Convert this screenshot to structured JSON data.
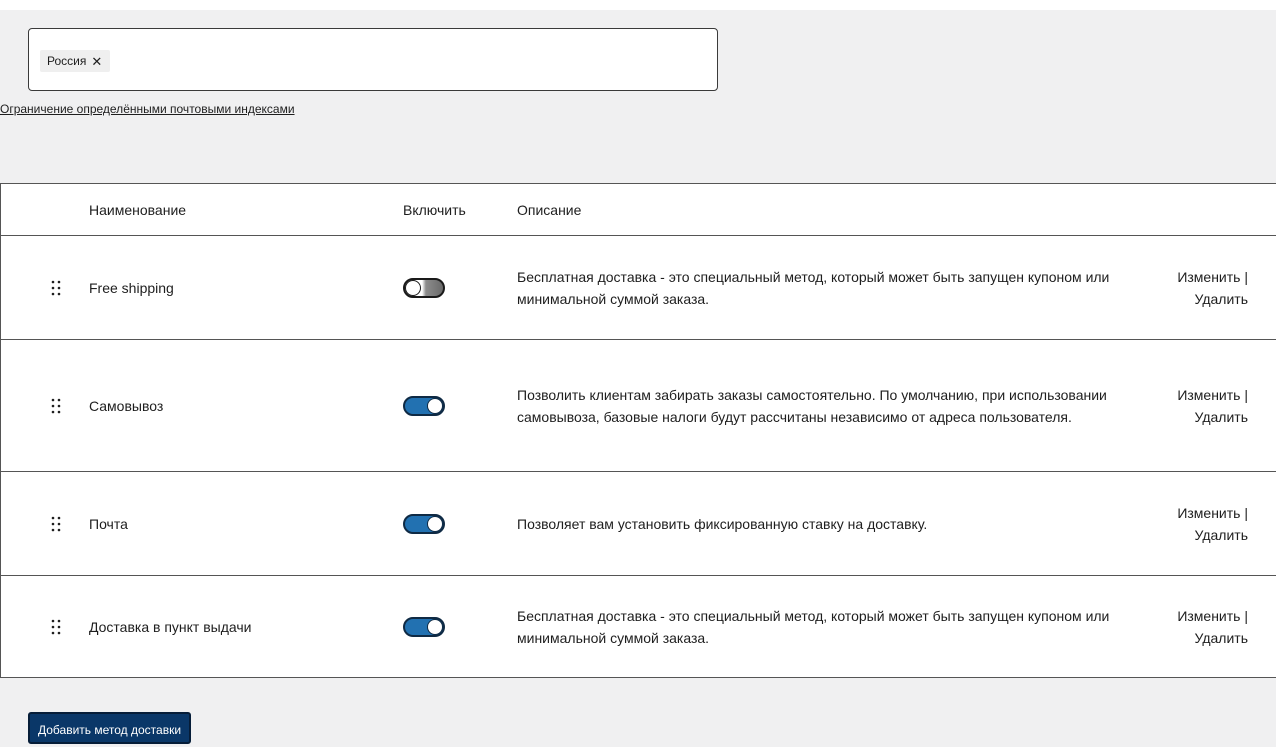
{
  "region": {
    "chips": [
      {
        "label": "Россия",
        "remove_glyph": "✕"
      }
    ]
  },
  "postcode_link": "Ограничение определёнными почтовыми индексами",
  "table": {
    "headers": {
      "name": "Наименование",
      "enable": "Включить",
      "description": "Описание"
    },
    "rows": [
      {
        "name": "Free shipping",
        "enabled": false,
        "description": "Бесплатная доставка - это специальный метод, который может быть запущен купоном или минимальной суммой заказа.",
        "edit_label": "Изменить",
        "separator": "|",
        "delete_label": "Удалить"
      },
      {
        "name": "Самовывоз",
        "enabled": true,
        "description": "Позволить клиентам забирать заказы самостоятельно. По умолчанию, при использовании самовывоза, базовые налоги будут рассчитаны независимо от адреса пользователя.",
        "edit_label": "Изменить",
        "separator": "|",
        "delete_label": "Удалить"
      },
      {
        "name": "Почта",
        "enabled": true,
        "description": "Позволяет вам установить фиксированную ставку на доставку.",
        "edit_label": "Изменить",
        "separator": "|",
        "delete_label": "Удалить"
      },
      {
        "name": "Доставка в пункт выдачи",
        "enabled": true,
        "description": "Бесплатная доставка - это специальный метод, который может быть запущен купоном или минимальной суммой заказа.",
        "edit_label": "Изменить",
        "separator": "|",
        "delete_label": "Удалить"
      }
    ]
  },
  "add_button_label": "Добавить метод доставки",
  "colors": {
    "toggle_on": "#2271b1",
    "button_bg": "#0a3768",
    "panel_bg": "#f0f0f1"
  },
  "icons": {
    "drag_handle": "drag-handle-icon",
    "chip_remove": "close-icon"
  }
}
